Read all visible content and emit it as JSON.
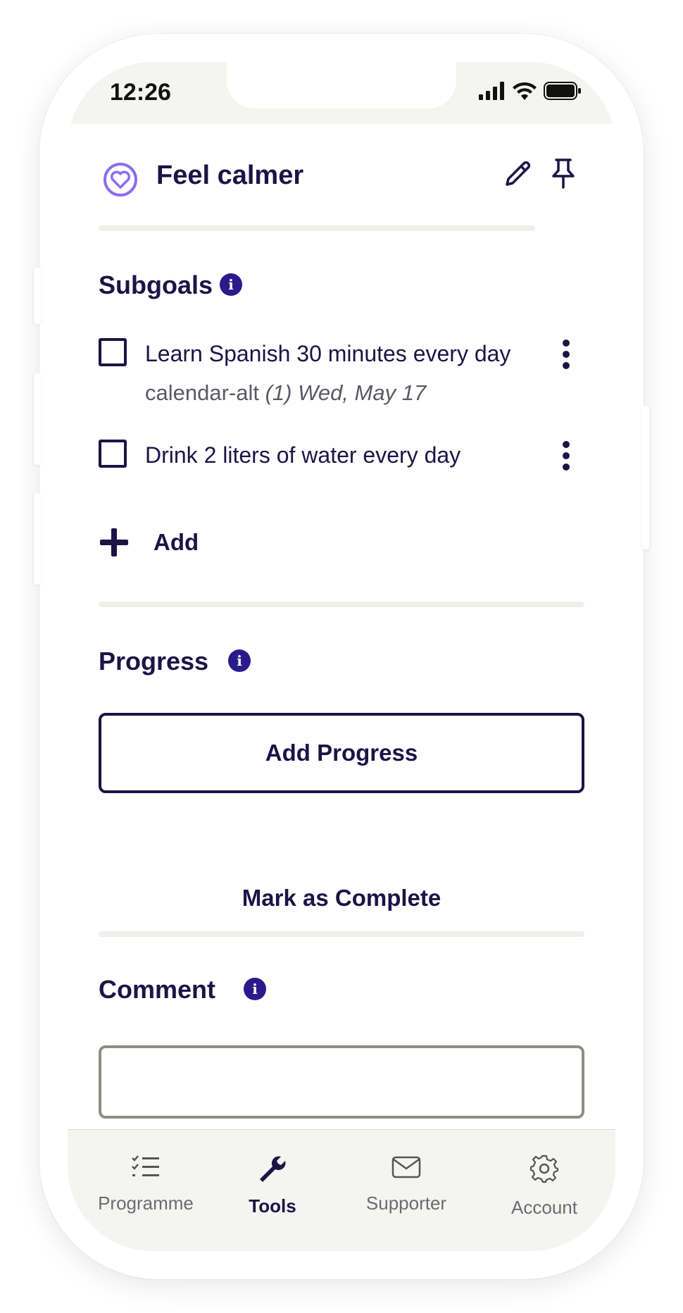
{
  "status_bar": {
    "time": "12:26"
  },
  "goal": {
    "title": "Feel calmer"
  },
  "subgoals": {
    "heading": "Subgoals",
    "items": [
      {
        "text": "Learn Spanish 30 minutes every day",
        "due_icon_text": "calendar-alt",
        "due_count": "(1)",
        "due_date": "Wed, May 17"
      },
      {
        "text": "Drink 2 liters of water every day"
      }
    ],
    "add_label": "Add"
  },
  "progress": {
    "heading": "Progress",
    "add_progress_label": "Add Progress",
    "mark_complete_label": "Mark as Complete"
  },
  "comment": {
    "heading": "Comment",
    "value": ""
  },
  "tabbar": {
    "tabs": [
      {
        "label": "Programme",
        "icon": "checklist-icon"
      },
      {
        "label": "Tools",
        "icon": "wrench-icon",
        "active": true
      },
      {
        "label": "Supporter",
        "icon": "envelope-icon"
      },
      {
        "label": "Account",
        "icon": "gear-icon"
      }
    ]
  },
  "colors": {
    "primary": "#1b1446",
    "accent_purple": "#8b6cf0",
    "info_badge": "#2a1a8a",
    "muted_bg": "#f4f4f0"
  }
}
